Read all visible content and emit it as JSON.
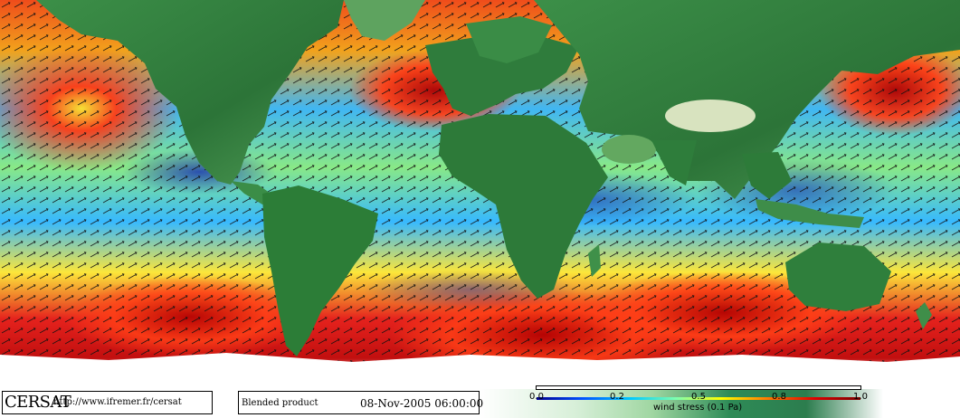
{
  "map": {
    "projection": "equirectangular",
    "field": "wind stress",
    "arrows": "wind direction vectors",
    "colors": {
      "ocean_low": "#1c2fb3",
      "ocean_mid_low": "#2aa9ff",
      "ocean_mid": "#8ee87f",
      "ocean_mid_high": "#f7f032",
      "ocean_high": "#e21b0b",
      "ocean_max": "#900000",
      "land_low": "#2f7c3c",
      "land_high": "#dfe8c7",
      "ice": "#ffffff"
    }
  },
  "credit": {
    "logo": "CERSAT",
    "url": "http://www.ifremer.fr/cersat"
  },
  "info": {
    "product": "Blended product",
    "date": "08-Nov-2005 06:00:00"
  },
  "colorbar": {
    "ticks": [
      "0.0",
      "0.2",
      "0.5",
      "0.8",
      "1.0"
    ],
    "tick_values": [
      0.0,
      0.2,
      0.5,
      0.8,
      1.0
    ],
    "min": 0.0,
    "max": 1.0,
    "label": "wind stress (0.1 Pa)",
    "colors": [
      "#000090",
      "#0050ff",
      "#00c8ff",
      "#7dffb0",
      "#ffff00",
      "#ff7a00",
      "#e00000",
      "#7a0000"
    ]
  }
}
